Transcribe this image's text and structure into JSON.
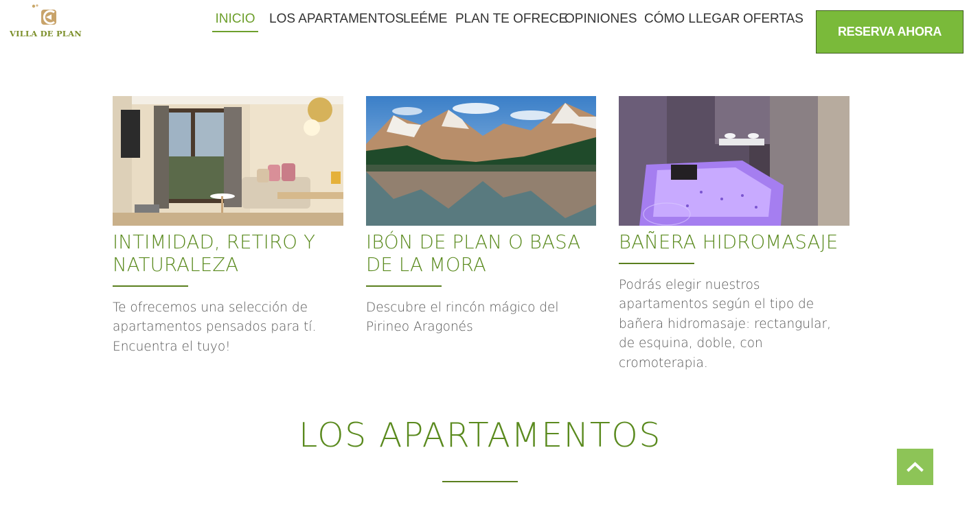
{
  "brand": {
    "name": "VILLA DE PLAN",
    "logo_icon": "villa-de-plan-logo-mark"
  },
  "nav": {
    "items": [
      {
        "label": "INICIO",
        "active": true
      },
      {
        "label": "LOS APARTAMENTOS",
        "active": false
      },
      {
        "label": "LEÉME",
        "active": false
      },
      {
        "label": "PLAN TE OFRECE",
        "active": false
      },
      {
        "label": "OPINIONES",
        "active": false
      },
      {
        "label": "CÓMO LLEGAR",
        "active": false
      },
      {
        "label": "OFERTAS",
        "active": false
      }
    ],
    "reserve_label": "RESERVA AHORA"
  },
  "features": [
    {
      "title": "INTIMIDAD, RETIRO Y NATURALEZA",
      "text": "Te ofrecemos una selección de apartamentos pensados para tí. Encuentra el tuyo!",
      "image": "apartment-living-room-photo"
    },
    {
      "title": "IBÓN DE PLAN O BASA DE LA MORA",
      "text": "Descubre el rincón mágico del Pirineo Aragonés",
      "image": "mountain-lake-photo"
    },
    {
      "title": "BAÑERA HIDROMASAJE",
      "text": "Podrás elegir nuestros apartamentos según el tipo de bañera hidromasaje: rectangular, de esquina, doble, con cromoterapia.",
      "image": "hydromassage-bathtub-photo"
    }
  ],
  "section": {
    "title": "LOS APARTAMENTOS"
  },
  "back_to_top_icon": "chevron-up-icon",
  "colors": {
    "accent_green": "#7aba3a",
    "heading_green": "#5a8a1e",
    "body_text": "#555555",
    "nav_text": "#333333"
  }
}
